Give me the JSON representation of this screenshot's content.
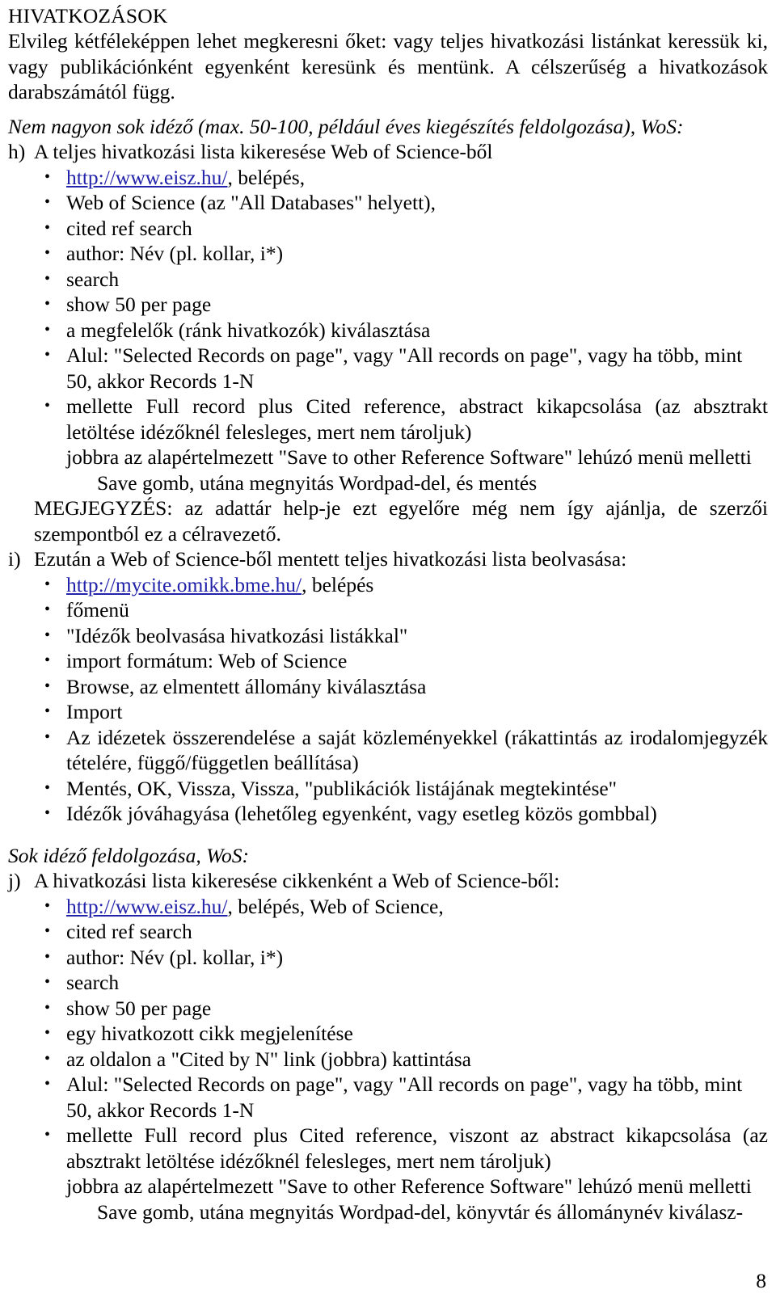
{
  "document": {
    "heading": "HIVATKOZÁSOK",
    "intro_paragraph": "Elvileg kétféleképpen lehet megkeresni őket: vagy teljes hivatkozási listánkat keressük ki, vagy publikációnként egyenként keresünk és mentünk. A célszerűség a hivatkozások darabszámától függ.",
    "page_number": "8"
  },
  "section_1": {
    "italic_lead": "Nem nagyon sok idéző (max. 50-100, például éves kiegészítés feldolgozása), WoS:",
    "item_h": {
      "marker": "h)",
      "text": "A teljes hivatkozási lista kikeresése Web of Science-ből",
      "bullets": [
        {
          "link": "http://www.eisz.hu/",
          "rest": ", belépés,"
        },
        {
          "text": "Web of Science (az \"All Databases\" helyett),"
        },
        {
          "text": "cited ref search"
        },
        {
          "text": "author: Név (pl. kollar, i*)"
        },
        {
          "text": "search"
        },
        {
          "text": "show 50 per page"
        },
        {
          "text": "a megfelelők (ránk hivatkozók) kiválasztása"
        },
        {
          "text": "Alul: \"Selected Records on page\", vagy \"All records on page\", vagy ha több, mint 50, akkor Records 1-N"
        },
        {
          "text": "mellette Full record plus Cited reference, abstract kikapcsolása (az absztrakt letöltése idézőknél felesleges, mert nem tároljuk)"
        }
      ],
      "continuation_1": "jobbra az alapértelmezett \"Save to other Reference Software\" lehúzó menü melletti",
      "continuation_2": "Save gomb, utána megnyitás Wordpad-del, és mentés",
      "note": "MEGJEGYZÉS: az adattár help-je ezt egyelőre még nem így ajánlja, de szerzői szempontból ez a célravezető."
    },
    "item_i": {
      "marker": "i)",
      "text": "Ezután a Web of Science-ből mentett teljes hivatkozási lista beolvasása:",
      "bullets": [
        {
          "link": "http://mycite.omikk.bme.hu/",
          "rest": ", belépés"
        },
        {
          "text": "főmenü"
        },
        {
          "text": "\"Idézők beolvasása hivatkozási listákkal\""
        },
        {
          "text": "import formátum: Web of Science"
        },
        {
          "text": "Browse, az elmentett állomány kiválasztása"
        },
        {
          "text": "Import"
        },
        {
          "text": "Az idézetek összerendelése a saját közleményekkel (rákattintás az irodalomjegyzék tételére, függő/független beállítása)"
        },
        {
          "text": "Mentés, OK, Vissza, Vissza, \"publikációk listájának megtekintése\""
        },
        {
          "text": "Idézők jóváhagyása (lehetőleg egyenként, vagy esetleg közös gombbal)"
        }
      ]
    }
  },
  "section_2": {
    "italic_lead": "Sok idéző feldolgozása, WoS:",
    "item_j": {
      "marker": "j)",
      "text": "A hivatkozási lista kikeresése cikkenként a Web of Science-ből:",
      "bullets": [
        {
          "link": "http://www.eisz.hu/",
          "rest": ", belépés, Web of Science,"
        },
        {
          "text": "cited ref search"
        },
        {
          "text": "author: Név (pl. kollar, i*)"
        },
        {
          "text": "search"
        },
        {
          "text": "show 50 per page"
        },
        {
          "text": "egy hivatkozott cikk megjelenítése"
        },
        {
          "text": "az oldalon a \"Cited by N\" link (jobbra) kattintása"
        },
        {
          "text": "Alul: \"Selected Records on page\", vagy \"All records on page\", vagy ha több, mint 50, akkor Records 1-N"
        },
        {
          "text": "mellette Full record plus Cited reference, viszont az abstract kikapcsolása (az absztrakt letöltése idézőknél felesleges, mert nem tároljuk)"
        }
      ],
      "continuation_1": "jobbra az alapértelmezett \"Save to other Reference Software\" lehúzó menü melletti",
      "continuation_2": "Save gomb, utána megnyitás Wordpad-del, könyvtár és állománynév kiválasz-"
    }
  },
  "bullet_glyph": "•",
  "link_color": "#2222aa"
}
